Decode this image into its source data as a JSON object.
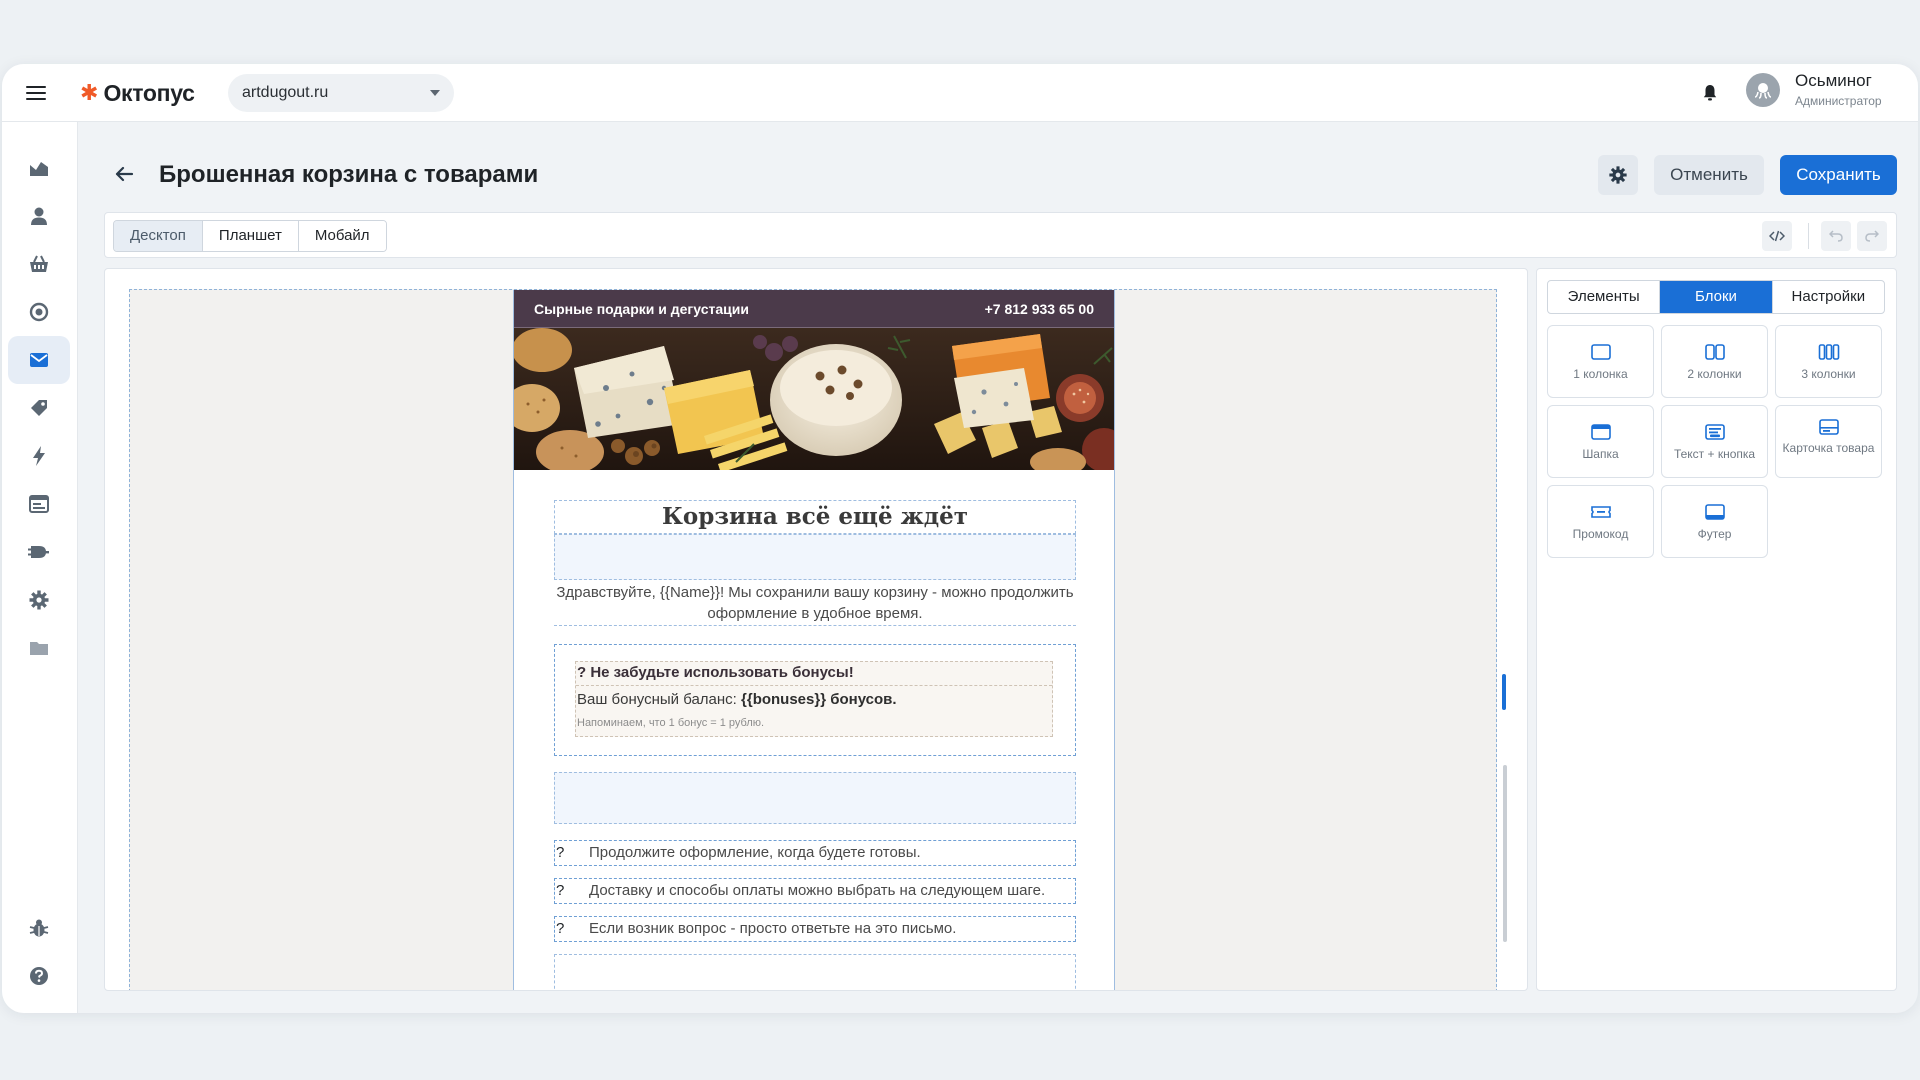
{
  "topbar": {
    "brand": "Октопус",
    "site": "artdugout.ru",
    "user_name": "Осьминог",
    "user_role": "Администратор"
  },
  "sidebar": {
    "items": [
      {
        "icon": "analytics-icon"
      },
      {
        "icon": "user-icon"
      },
      {
        "icon": "basket-icon"
      },
      {
        "icon": "target-icon"
      },
      {
        "icon": "mail-icon",
        "active": true
      },
      {
        "icon": "tag-icon"
      },
      {
        "icon": "lightning-icon"
      },
      {
        "icon": "browser-window-icon"
      },
      {
        "icon": "plug-icon"
      },
      {
        "icon": "gear-icon"
      },
      {
        "icon": "folder-icon"
      },
      {
        "icon": "bug-icon"
      },
      {
        "icon": "help-icon"
      }
    ]
  },
  "page": {
    "title": "Брошенная корзина с товарами",
    "cancel_label": "Отменить",
    "save_label": "Сохранить"
  },
  "toolbar": {
    "device_tabs": [
      "Десктоп",
      "Планшет",
      "Мобайл"
    ],
    "active_device": "Десктоп"
  },
  "email": {
    "header_brand": "Сырные подарки и дегустации",
    "header_phone": "+7 812 933 65 00",
    "title": "Корзина всё ещё ждёт",
    "greeting": "Здравствуйте, {{Name}}! Мы сохранили вашу корзину - можно продолжить оформление в удобное время.",
    "bonus_title": "? Не забудьте использовать бонусы!",
    "bonus_balance_prefix": "Ваш бонусный баланс: ",
    "bonus_balance_value": "{{bonuses}} бонусов.",
    "bonus_note": "Напоминаем, что 1 бонус = 1 рублю.",
    "list": [
      {
        "marker": "?",
        "text": "Продолжите оформление, когда будете готовы."
      },
      {
        "marker": "?",
        "text": "Доставку и способы оплаты можно выбрать на следующем шаге."
      },
      {
        "marker": "?",
        "text": "Если возник вопрос - просто ответьте на это письмо."
      }
    ]
  },
  "panel": {
    "tabs": [
      "Элементы",
      "Блоки",
      "Настройки"
    ],
    "active_tab": "Блоки",
    "blocks": [
      {
        "label": "1 колонка",
        "icon": "one-column-icon"
      },
      {
        "label": "2 колонки",
        "icon": "two-columns-icon"
      },
      {
        "label": "3 колонки",
        "icon": "three-columns-icon"
      },
      {
        "label": "Шапка",
        "icon": "header-block-icon"
      },
      {
        "label": "Текст + кнопка",
        "icon": "text-button-icon"
      },
      {
        "label": "Карточка товара",
        "icon": "product-card-icon"
      },
      {
        "label": "Промокод",
        "icon": "promo-code-icon"
      },
      {
        "label": "Футер",
        "icon": "footer-block-icon"
      }
    ]
  },
  "colors": {
    "accent": "#1a6fd6",
    "email_header": "#4b3a4a",
    "brand_mark": "#f05a28"
  }
}
